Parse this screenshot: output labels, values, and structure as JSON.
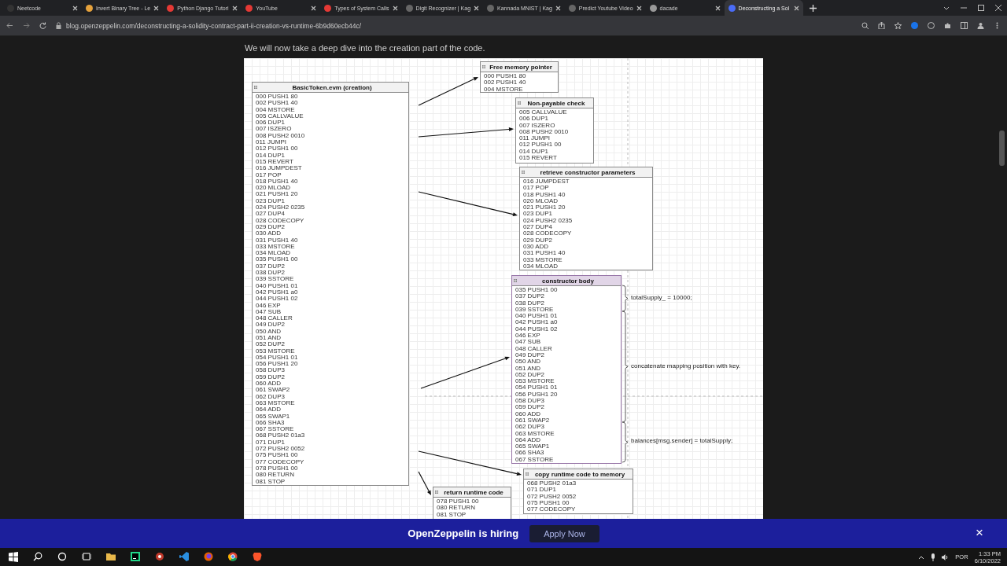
{
  "tabs": [
    {
      "title": "Neetcode",
      "selected": false
    },
    {
      "title": "Invert Binary Tree - Le",
      "selected": false
    },
    {
      "title": "Python Django Tutori",
      "selected": false
    },
    {
      "title": "YouTube",
      "selected": false
    },
    {
      "title": "Types of System Calls",
      "selected": false
    },
    {
      "title": "Digit Recognizer | Kag",
      "selected": false
    },
    {
      "title": "Kannada MNIST | Kag",
      "selected": false
    },
    {
      "title": "Predict Youtube Video",
      "selected": false
    },
    {
      "title": "dacade",
      "selected": false
    },
    {
      "title": "Deconstructing a Sol",
      "selected": true
    }
  ],
  "address_bar": {
    "url": "blog.openzeppelin.com/deconstructing-a-solidity-contract-part-ii-creation-vs-runtime-6b9d60ecb44c/"
  },
  "article": {
    "paragraph": "We will now take a deep dive into the creation part of the code.",
    "diagram": {
      "boxes": [
        {
          "title": "BasicToken.evm (creation)",
          "selected": false,
          "lines": [
            "000 PUSH1 80",
            "002 PUSH1 40",
            "004 MSTORE",
            "005 CALLVALUE",
            "006 DUP1",
            "007 ISZERO",
            "008 PUSH2 0010",
            "011 JUMPI",
            "012 PUSH1 00",
            "014 DUP1",
            "015 REVERT",
            "016 JUMPDEST",
            "017 POP",
            "018 PUSH1 40",
            "020 MLOAD",
            "021 PUSH1 20",
            "023 DUP1",
            "024 PUSH2 0235",
            "027 DUP4",
            "028 CODECOPY",
            "029 DUP2",
            "030 ADD",
            "031 PUSH1 40",
            "033 MSTORE",
            "034 MLOAD",
            "035 PUSH1 00",
            "037 DUP2",
            "038 DUP2",
            "039 SSTORE",
            "040 PUSH1 01",
            "042 PUSH1 a0",
            "044 PUSH1 02",
            "046 EXP",
            "047 SUB",
            "048 CALLER",
            "049 DUP2",
            "050 AND",
            "051 AND",
            "052 DUP2",
            "053 MSTORE",
            "054 PUSH1 01",
            "056 PUSH1 20",
            "058 DUP3",
            "059 DUP2",
            "060 ADD",
            "061 SWAP2",
            "062 DUP3",
            "063 MSTORE",
            "064 ADD",
            "065 SWAP1",
            "066 SHA3",
            "067 SSTORE",
            "068 PUSH2 01a3",
            "071 DUP1",
            "072 PUSH2 0052",
            "075 PUSH1 00",
            "077 CODECOPY",
            "078 PUSH1 00",
            "080 RETURN",
            "081 STOP"
          ]
        },
        {
          "title": "Free memory pointer",
          "selected": false,
          "lines": [
            "000 PUSH1 80",
            "002 PUSH1 40",
            "004 MSTORE"
          ]
        },
        {
          "title": "Non-payable check",
          "selected": false,
          "lines": [
            "005 CALLVALUE",
            "006 DUP1",
            "007 ISZERO",
            "008 PUSH2 0010",
            "011 JUMPI",
            "012 PUSH1 00",
            "014 DUP1",
            "015 REVERT"
          ]
        },
        {
          "title": "retrieve constructor parameters",
          "selected": false,
          "lines": [
            "016 JUMPDEST",
            "017 POP",
            "018 PUSH1 40",
            "020 MLOAD",
            "021 PUSH1 20",
            "023 DUP1",
            "024 PUSH2 0235",
            "027 DUP4",
            "028 CODECOPY",
            "029 DUP2",
            "030 ADD",
            "031 PUSH1 40",
            "033 MSTORE",
            "034 MLOAD"
          ]
        },
        {
          "title": "constructor body",
          "selected": true,
          "lines": [
            "035 PUSH1 00",
            "037 DUP2",
            "038 DUP2",
            "039 SSTORE",
            "040 PUSH1 01",
            "042 PUSH1 a0",
            "044 PUSH1 02",
            "046 EXP",
            "047 SUB",
            "048 CALLER",
            "049 DUP2",
            "050 AND",
            "051 AND",
            "052 DUP2",
            "053 MSTORE",
            "054 PUSH1 01",
            "056 PUSH1 20",
            "058 DUP3",
            "059 DUP2",
            "060 ADD",
            "061 SWAP2",
            "062 DUP3",
            "063 MSTORE",
            "064 ADD",
            "065 SWAP1",
            "066 SHA3",
            "067 SSTORE"
          ]
        },
        {
          "title": "return runtime code",
          "selected": false,
          "lines": [
            "078 PUSH1 00",
            "080 RETURN",
            "081 STOP"
          ]
        },
        {
          "title": "copy runtime code to memory",
          "selected": false,
          "lines": [
            "068 PUSH2 01a3",
            "071 DUP1",
            "072 PUSH2 0052",
            "075 PUSH1 00",
            "077 CODECOPY"
          ]
        }
      ],
      "annotations": [
        "totalSupply_ = 10000;",
        "concatenate mapping position with key.",
        "balances[msg.sender] = totalSupply;"
      ]
    }
  },
  "banner": {
    "text": "OpenZeppelin is hiring",
    "button": "Apply Now",
    "close": "×"
  },
  "taskbar": {
    "language": "POR",
    "time": "1:33 PM",
    "date": "6/10/2022"
  }
}
